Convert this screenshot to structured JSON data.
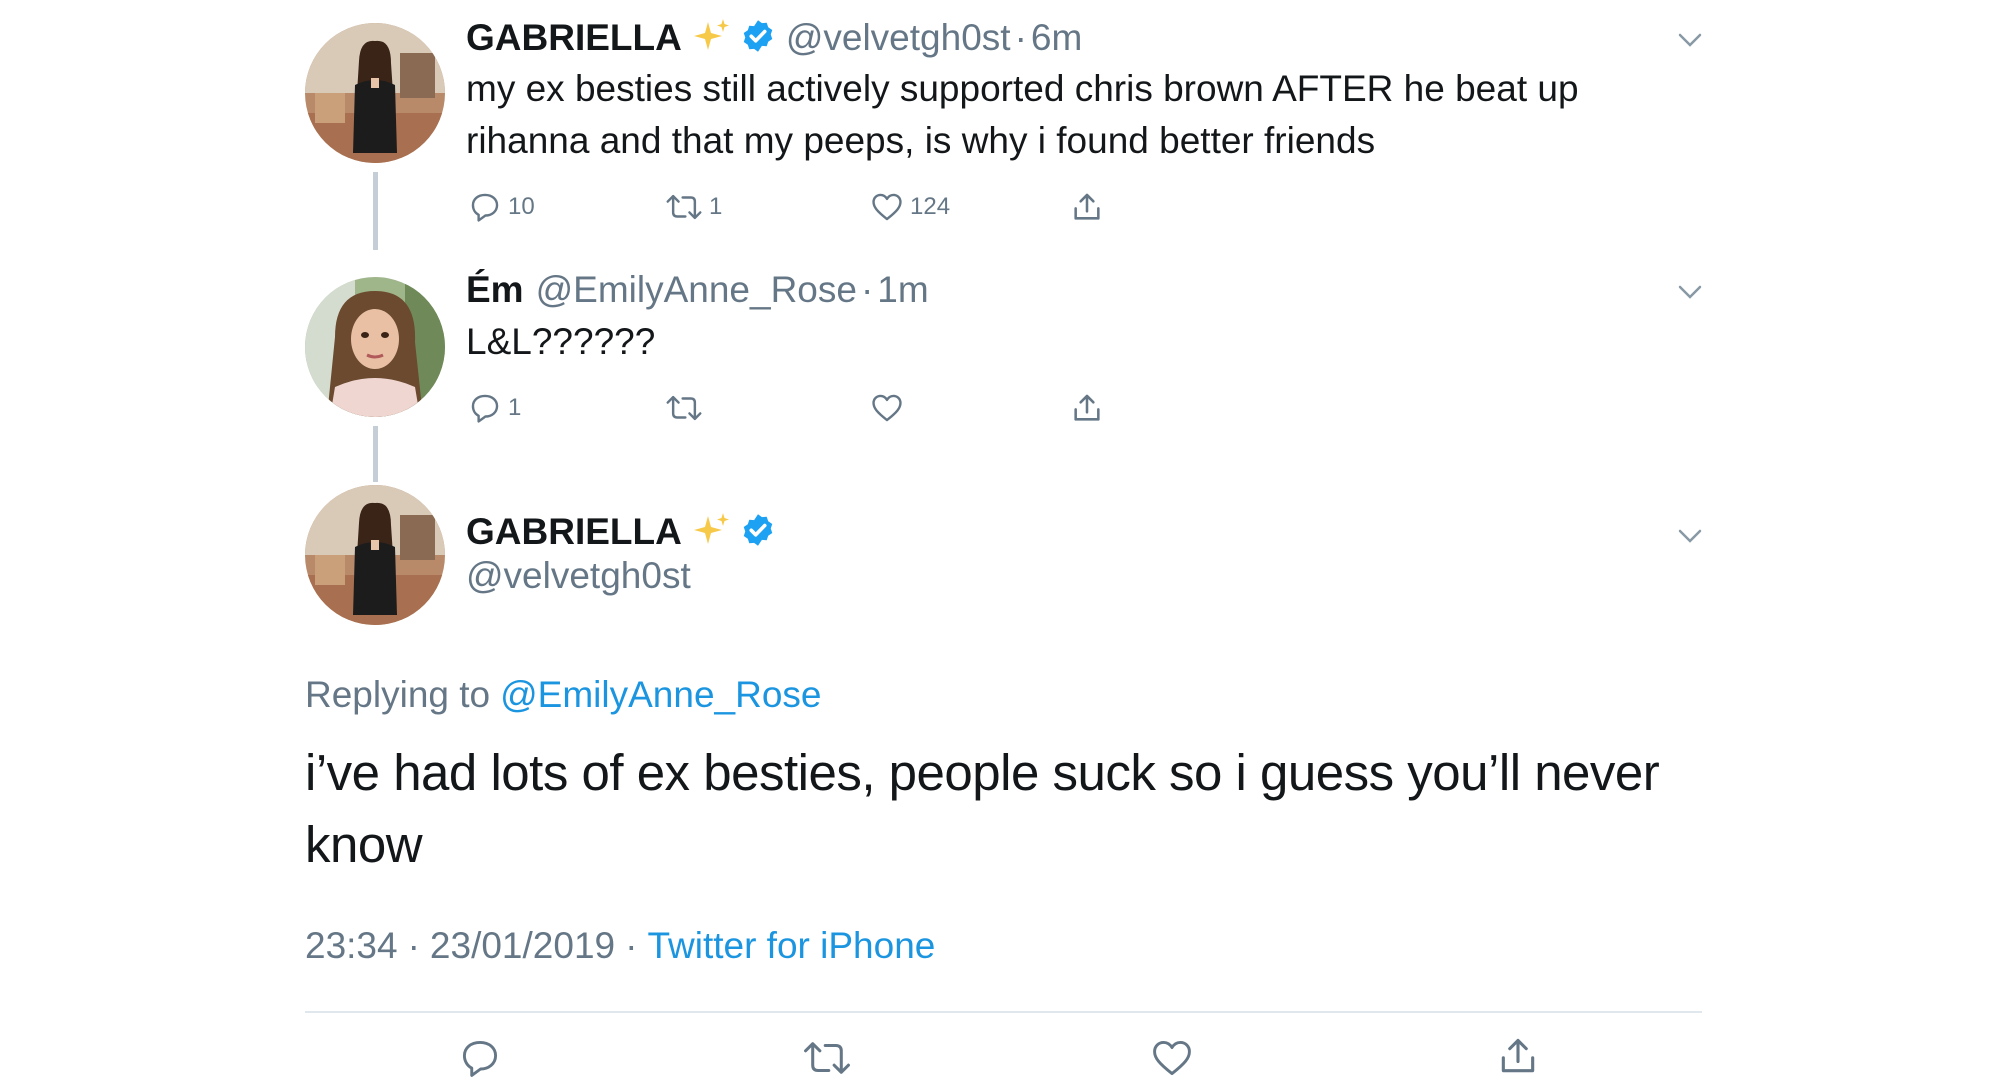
{
  "tweets": [
    {
      "name": "GABRIELLA",
      "handle": "@velvetgh0st",
      "sep": "·",
      "time": "6m",
      "text_line1": "my ex besties still actively supported chris brown AFTER he beat up",
      "text_line2": "rihanna and that my peeps, is why i found better friends",
      "replies": "10",
      "retweets": "1",
      "likes": "124"
    },
    {
      "name": "Ém",
      "handle": "@EmilyAnne_Rose",
      "sep": "·",
      "time": "1m",
      "text_line1": "L&L??????",
      "replies": "1",
      "retweets": "",
      "likes": ""
    }
  ],
  "main_tweet": {
    "name": "GABRIELLA",
    "handle": "@velvetgh0st",
    "replying_prefix": "Replying to",
    "replying_handle": "@EmilyAnne_Rose",
    "text_line1": "i’ve had lots of ex besties, people suck so i guess you’ll never",
    "text_line2": "know",
    "time": "23:34",
    "sep1": "·",
    "date": "23/01/2019",
    "sep2": "·",
    "source": "Twitter for iPhone"
  },
  "icons": {
    "reply": "reply-icon",
    "retweet": "retweet-icon",
    "like": "heart-icon",
    "share": "share-icon",
    "verified": "verified-badge-icon",
    "sparkles": "sparkles-emoji",
    "more": "chevron-down-icon"
  },
  "colors": {
    "accent": "#1b95e0",
    "verified": "#1da1f2",
    "secondary_text": "#657786",
    "sparkle": "#f7c948"
  }
}
